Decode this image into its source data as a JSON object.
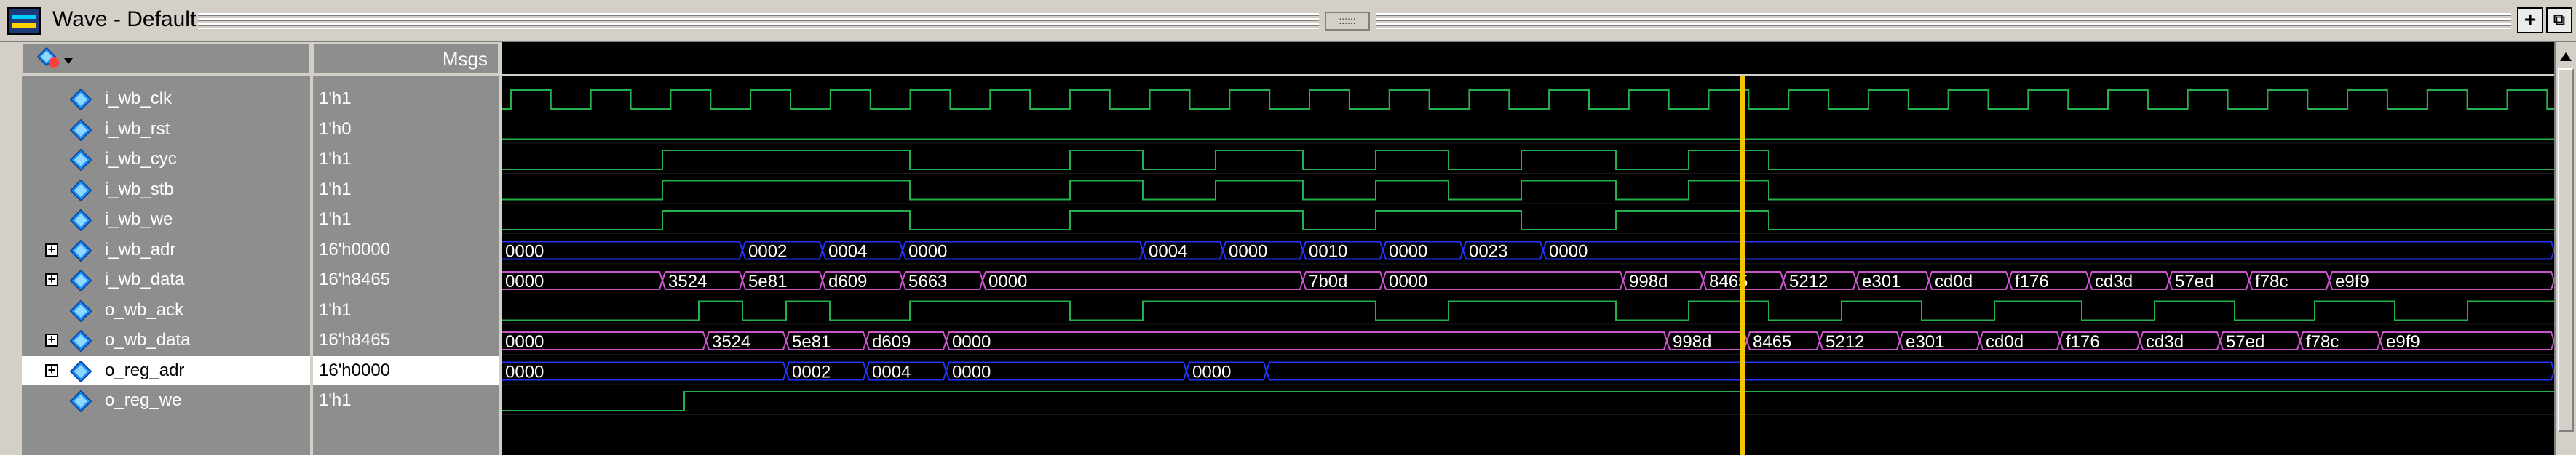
{
  "window": {
    "title": "Wave - Default",
    "grip_label": "::::::",
    "buttons": [
      {
        "name": "add-pane-button",
        "label": "+"
      },
      {
        "name": "undock-button",
        "label": "⧉"
      }
    ]
  },
  "header": {
    "msgs_label": "Msgs"
  },
  "signals": [
    {
      "name": "i_wb_clk",
      "value": "1'h1",
      "expandable": false,
      "selected": false
    },
    {
      "name": "i_wb_rst",
      "value": "1'h0",
      "expandable": false,
      "selected": false
    },
    {
      "name": "i_wb_cyc",
      "value": "1'h1",
      "expandable": false,
      "selected": false
    },
    {
      "name": "i_wb_stb",
      "value": "1'h1",
      "expandable": false,
      "selected": false
    },
    {
      "name": "i_wb_we",
      "value": "1'h1",
      "expandable": false,
      "selected": false
    },
    {
      "name": "i_wb_adr",
      "value": "16'h0000",
      "expandable": true,
      "selected": false
    },
    {
      "name": "i_wb_data",
      "value": "16'h8465",
      "expandable": true,
      "selected": false
    },
    {
      "name": "o_wb_ack",
      "value": "1'h1",
      "expandable": false,
      "selected": false
    },
    {
      "name": "o_wb_data",
      "value": "16'h8465",
      "expandable": true,
      "selected": false
    },
    {
      "name": "o_reg_adr",
      "value": "16'h0000",
      "expandable": true,
      "selected": true
    },
    {
      "name": "o_reg_we",
      "value": "1'h1",
      "expandable": false,
      "selected": false
    }
  ],
  "bus_labels": {
    "i_wb_adr": [
      "0000",
      "0002",
      "0004",
      "0000",
      "0004",
      "0000",
      "0010",
      "0000",
      "0023",
      "0000"
    ],
    "i_wb_data": [
      "0000",
      "3524",
      "5e81",
      "d609",
      "5663",
      "0000",
      "7b0d",
      "0000",
      "998d",
      "8465",
      "5212",
      "e301",
      "cd0d",
      "f176",
      "cd3d",
      "57ed",
      "f78c",
      "e9f9"
    ],
    "o_wb_data": [
      "0000",
      "3524",
      "5e81",
      "d609",
      "0000",
      "998d",
      "8465",
      "5212",
      "e301",
      "cd0d",
      "f176",
      "cd3d",
      "57ed",
      "f78c",
      "e9f9"
    ],
    "o_reg_adr": [
      "0000",
      "0002",
      "0004",
      "0000",
      "0000"
    ]
  },
  "colors": {
    "wave_bg": "#000000",
    "clk_green": "#22b14c",
    "bus_blue": "#2233ff",
    "bus_magenta": "#cc55cc",
    "cursor": "#f2c500",
    "text_white": "#ffffff"
  }
}
